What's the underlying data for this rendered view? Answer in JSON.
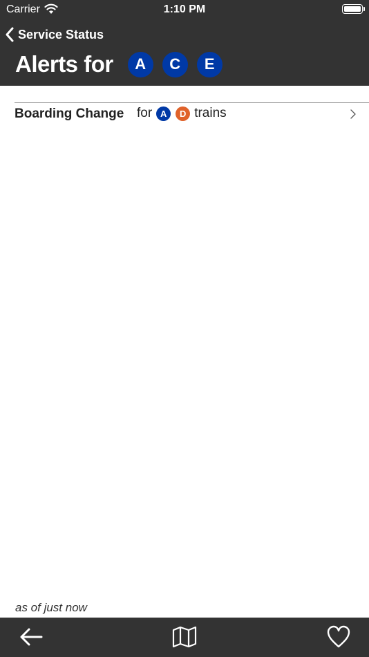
{
  "status_bar": {
    "carrier": "Carrier",
    "time": "1:10 PM"
  },
  "nav": {
    "back_label": "Service Status"
  },
  "header": {
    "title": "Alerts for",
    "routes": [
      {
        "label": "A",
        "color": "#0039a6"
      },
      {
        "label": "C",
        "color": "#0039a6"
      },
      {
        "label": "E",
        "color": "#0039a6"
      }
    ]
  },
  "alerts": [
    {
      "title": "Boarding Change",
      "prefix": "for",
      "routes": [
        {
          "label": "A",
          "color": "#0039a6"
        },
        {
          "label": "D",
          "color": "#e0622a"
        }
      ],
      "suffix": "trains"
    }
  ],
  "footer": {
    "updated": "as of just now"
  },
  "tab_bar": {
    "icons": [
      "arrow-left-icon",
      "map-icon",
      "heart-icon"
    ]
  }
}
